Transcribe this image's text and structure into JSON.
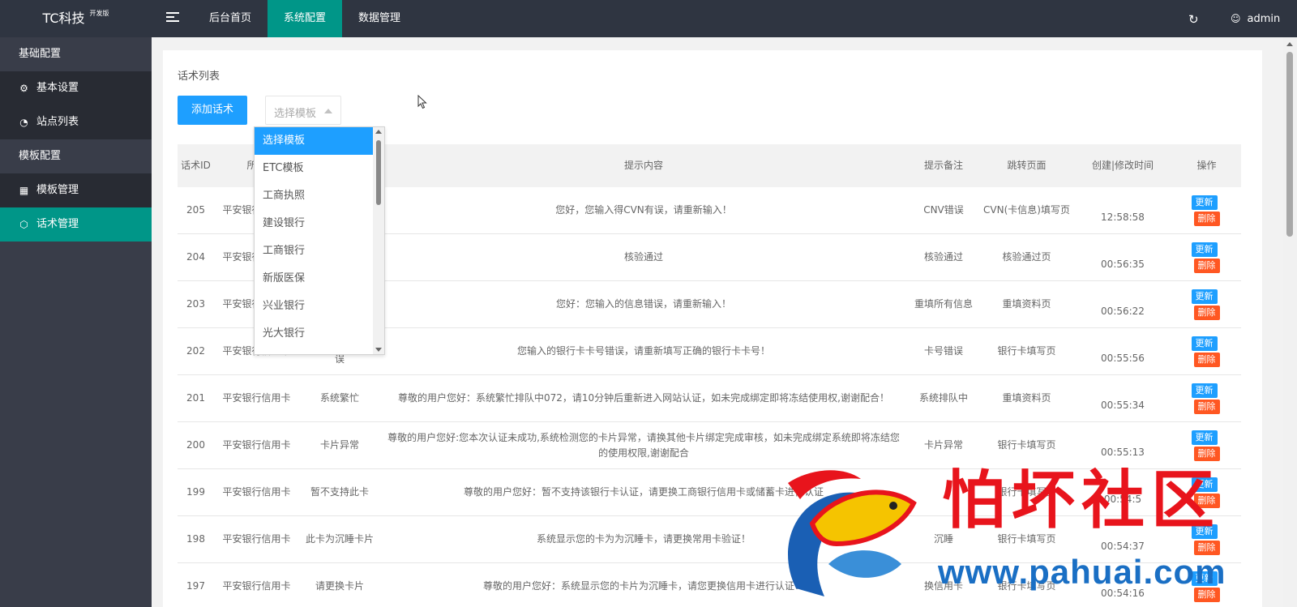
{
  "header": {
    "logo": "TC科技",
    "logo_sup": "开发版",
    "tabs": [
      {
        "label": "后台首页"
      },
      {
        "label": "系统配置"
      },
      {
        "label": "数据管理"
      }
    ],
    "user": "admin"
  },
  "sidebar": {
    "groups": [
      {
        "label": "基础配置",
        "items": [
          {
            "label": "基本设置",
            "icon": "gear-icon"
          },
          {
            "label": "站点列表",
            "icon": "dashboard-icon"
          }
        ]
      },
      {
        "label": "模板配置",
        "items": [
          {
            "label": "模板管理",
            "icon": "apps-icon"
          },
          {
            "label": "话术管理",
            "icon": "cube-icon"
          }
        ]
      }
    ]
  },
  "main": {
    "title": "话术列表",
    "add_button": "添加话术",
    "select_placeholder": "选择模板",
    "dropdown_options": [
      "选择模板",
      "ETC模板",
      "工商执照",
      "建设银行",
      "工商银行",
      "新版医保",
      "兴业银行",
      "光大银行"
    ],
    "columns": [
      "话术ID",
      "所属",
      "提示内容",
      "提示备注",
      "跳转页面",
      "创建|修改时间",
      "操作"
    ],
    "update_label": "更新",
    "delete_label": "删除",
    "rows": [
      {
        "id": "205",
        "bank": "平安银行信用卡",
        "name": "",
        "content": "您好，您输入得CVN有误，请重新输入！",
        "note": "CNV错误",
        "page": "CVN(卡信息)填写页",
        "time": "12:58:58"
      },
      {
        "id": "204",
        "bank": "平安银行信用卡",
        "name": "",
        "content": "核验通过",
        "note": "核验通过",
        "page": "核验通过页",
        "time": "00:56:35"
      },
      {
        "id": "203",
        "bank": "平安银行信用卡",
        "name": "",
        "content": "您好：您输入的信息错误，请重新输入！",
        "note": "重填所有信息",
        "page": "重填资料页",
        "time": "00:56:22"
      },
      {
        "id": "202",
        "bank": "平安银行信用卡",
        "name": "您输入得卡片有误",
        "content": "您输入的银行卡卡号错误，请重新填写正确的银行卡卡号！",
        "note": "卡号错误",
        "page": "银行卡填写页",
        "time": "00:55:56"
      },
      {
        "id": "201",
        "bank": "平安银行信用卡",
        "name": "系统繁忙",
        "content": "尊敬的用户您好：系统繁忙排队中072，请10分钟后重新进入网站认证，如未完成绑定即将冻结使用权,谢谢配合！",
        "note": "系统排队中",
        "page": "重填资料页",
        "time": "00:55:34"
      },
      {
        "id": "200",
        "bank": "平安银行信用卡",
        "name": "卡片异常",
        "content": "尊敬的用户您好:您本次认证未成功,系统检测您的卡片异常，请换其他卡片绑定完成审核，如未完成绑定系统即将冻结您的使用权限,谢谢配合",
        "note": "卡片异常",
        "page": "银行卡填写页",
        "time": "00:55:13"
      },
      {
        "id": "199",
        "bank": "平安银行信用卡",
        "name": "暂不支持此卡",
        "content": "尊敬的用户您好：暂不支持该银行卡认证，请更换工商银行信用卡或储蓄卡进行认证",
        "note": "",
        "page": "银行卡填写页",
        "time": "00:54:5"
      },
      {
        "id": "198",
        "bank": "平安银行信用卡",
        "name": "此卡为沉睡卡片",
        "content": "系统显示您的卡为为沉睡卡，请更换常用卡验证！",
        "note": "沉睡",
        "page": "银行卡填写页",
        "time": "00:54:37"
      },
      {
        "id": "197",
        "bank": "平安银行信用卡",
        "name": "请更换卡片",
        "content": "尊敬的用户您好：系统显示您的卡片为沉睡卡，请您更换信用卡进行认证！",
        "note": "换信用卡",
        "page": "银行卡填写页",
        "time": "00:54:16"
      }
    ]
  },
  "watermark": {
    "title": "怕坏社区",
    "url": "www.pahuai.com"
  }
}
